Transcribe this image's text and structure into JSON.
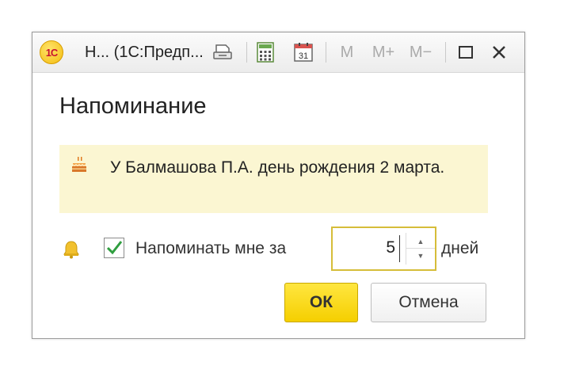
{
  "window": {
    "title": "Н...  (1С:Предп...",
    "logo_text": "1С",
    "toolbar": {
      "print_icon": "printer-icon",
      "calc_icon": "calculator-icon",
      "calendar_icon": "calendar-icon",
      "calendar_day": "31",
      "m_label": "M",
      "m_plus_label": "M+",
      "m_minus_label": "M−",
      "maximize_icon": "maximize-icon",
      "close_icon": "close-icon"
    }
  },
  "dialog": {
    "heading": "Напоминание",
    "message": "У Балмашова П.А. день рождения 2 марта.",
    "message_icon": "cake-icon",
    "reminder": {
      "bell_icon": "bell-icon",
      "checked": true,
      "label": "Напоминать мне за",
      "value": "5",
      "unit": "дней"
    },
    "buttons": {
      "ok": "ОК",
      "cancel": "Отмена"
    }
  },
  "colors": {
    "accent_yellow": "#f5cf00",
    "note_background": "#fbf6d2",
    "check_green": "#2f9e3f",
    "logo_red": "#c8102e"
  }
}
